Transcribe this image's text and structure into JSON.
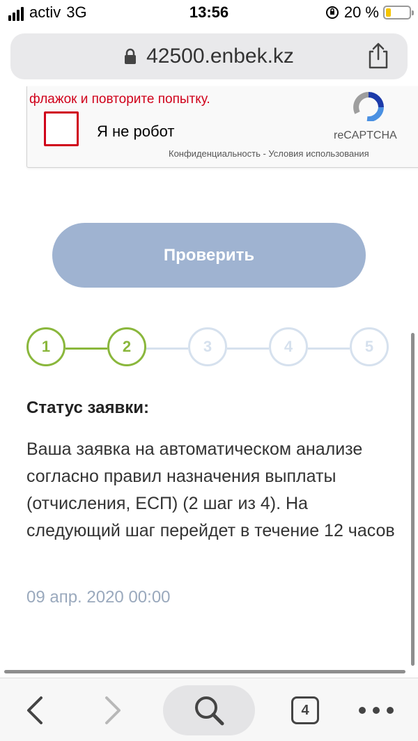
{
  "status_bar": {
    "carrier": "activ",
    "network": "3G",
    "time": "13:56",
    "battery": "20 %"
  },
  "url_bar": {
    "domain": "42500.enbek.kz"
  },
  "captcha": {
    "error_text": "флажок и повторите попытку.",
    "checkbox_label": "Я не робот",
    "brand": "reCAPTCHA",
    "links": "Конфиденциальность - Условия использования"
  },
  "check_button": {
    "label": "Проверить"
  },
  "steps": {
    "items": [
      {
        "label": "1",
        "state": "done"
      },
      {
        "label": "2",
        "state": "active"
      },
      {
        "label": "3",
        "state": "pending"
      },
      {
        "label": "4",
        "state": "pending"
      },
      {
        "label": "5",
        "state": "pending"
      }
    ],
    "colors": {
      "done": "#8ab73c",
      "pending": "#d6e1ee"
    }
  },
  "status": {
    "title": "Статус заявки:",
    "body": "Ваша заявка на автоматическом анализе согласно правил назначения выплаты (отчисления, ЕСП) (2 шаг из 4). На следующий шаг перейдет в течение 12 часов",
    "date": "09 апр. 2020 00:00"
  },
  "toolbar": {
    "tab_count": "4",
    "icons": [
      "back-icon",
      "forward-icon",
      "search-icon",
      "tabs-icon",
      "more-icon"
    ]
  },
  "colors": {
    "accent_green": "#8ab73c",
    "button_blue": "#9fb3d1",
    "error_red": "#d0021b",
    "date_gray": "#9aa9bd"
  }
}
